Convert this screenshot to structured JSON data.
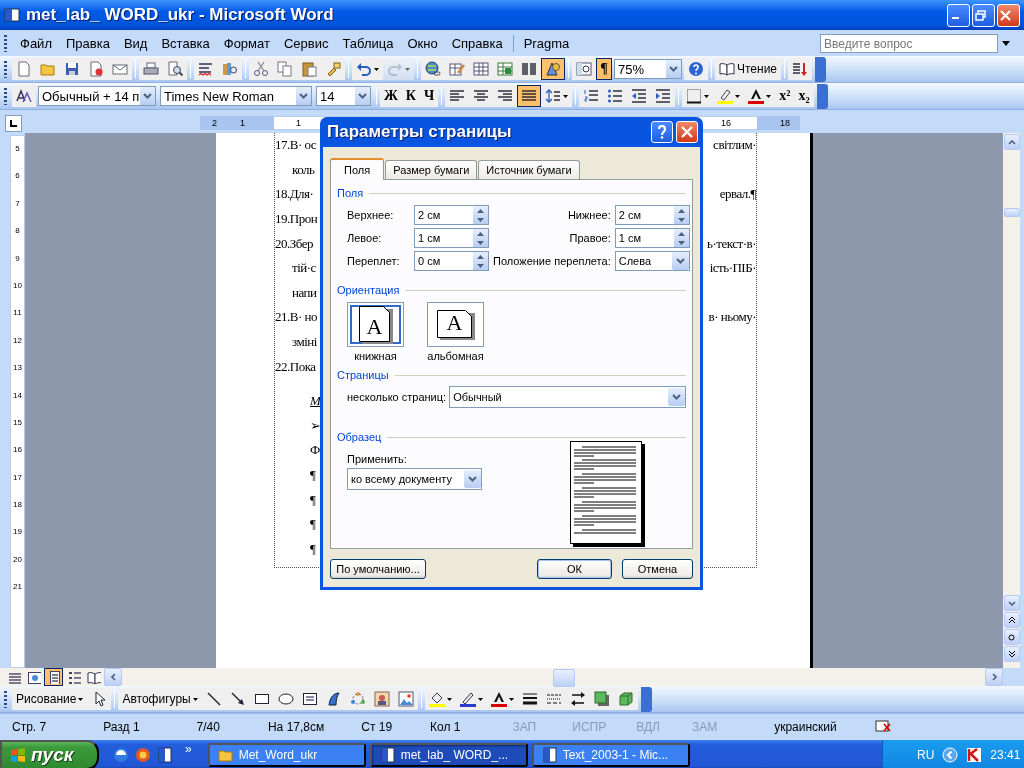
{
  "window": {
    "title": "met_lab_ WORD_ukr - Microsoft Word"
  },
  "menu": {
    "items": [
      "Файл",
      "Правка",
      "Вид",
      "Вставка",
      "Формат",
      "Сервис",
      "Таблица",
      "Окно",
      "Справка"
    ],
    "extra": [
      "Pragma"
    ],
    "help_box": {
      "placeholder": "Введите вопрос"
    }
  },
  "standard_toolbar": [
    [
      {
        "kind": "new",
        "pressed": false,
        "disabled": false
      },
      {
        "kind": "open",
        "pressed": false,
        "disabled": false
      },
      {
        "kind": "save",
        "pressed": false,
        "disabled": false
      },
      {
        "kind": "perm",
        "pressed": false,
        "disabled": false
      },
      {
        "kind": "mail",
        "pressed": false,
        "disabled": false
      }
    ],
    [
      {
        "kind": "print",
        "pressed": false,
        "disabled": false
      },
      {
        "kind": "preview",
        "pressed": false,
        "disabled": false
      }
    ],
    [
      {
        "kind": "spell",
        "pressed": false,
        "disabled": false
      },
      {
        "kind": "research",
        "pressed": false,
        "disabled": false
      }
    ],
    [
      {
        "kind": "cut",
        "pressed": false,
        "disabled": false
      },
      {
        "kind": "copy",
        "pressed": false,
        "disabled": false
      },
      {
        "kind": "paste",
        "pressed": false,
        "disabled": false
      },
      {
        "kind": "painter",
        "pressed": false,
        "disabled": false
      }
    ],
    [
      {
        "kind": "undo",
        "pressed": false,
        "disabled": false
      },
      {
        "kind": "redo",
        "pressed": false,
        "disabled": true
      }
    ],
    [
      {
        "kind": "link",
        "pressed": false,
        "disabled": false
      },
      {
        "kind": "tables",
        "pressed": false,
        "disabled": false
      },
      {
        "kind": "table",
        "pressed": false,
        "disabled": false
      },
      {
        "kind": "excel",
        "pressed": false,
        "disabled": false
      },
      {
        "kind": "columns",
        "pressed": false,
        "disabled": false
      },
      {
        "kind": "drawing",
        "pressed": true,
        "disabled": false
      }
    ],
    [
      {
        "kind": "docmap",
        "pressed": false,
        "disabled": false
      },
      {
        "kind": "text",
        "label": "¶",
        "pressed": true,
        "disabled": false
      },
      {
        "kind": "zoom",
        "value": "75%",
        "pressed": false,
        "disabled": false
      },
      {
        "kind": "help",
        "pressed": false,
        "disabled": false
      }
    ],
    [
      {
        "kind": "reading",
        "label": "Чтение",
        "pressed": false,
        "disabled": false
      }
    ],
    [
      {
        "kind": "sortlist",
        "pressed": false,
        "disabled": false
      }
    ]
  ],
  "formatting_toolbar": [
    [
      {
        "kind": "styles",
        "pressed": false,
        "disabled": false
      },
      {
        "kind": "style",
        "value": "Обычный + 14 п",
        "pressed": false,
        "disabled": false
      },
      {
        "kind": "font",
        "value": "Times New Roman",
        "pressed": false,
        "disabled": false
      },
      {
        "kind": "size",
        "value": "14",
        "pressed": false,
        "disabled": false
      }
    ],
    [
      {
        "kind": "text",
        "label": "Ж",
        "pressed": false,
        "disabled": false
      },
      {
        "kind": "text",
        "label": "К",
        "pressed": false,
        "disabled": false
      },
      {
        "kind": "text",
        "label": "Ч",
        "pressed": false,
        "disabled": false
      }
    ],
    [
      {
        "kind": "left",
        "pressed": false,
        "disabled": false
      },
      {
        "kind": "center",
        "pressed": false,
        "disabled": false
      },
      {
        "kind": "right",
        "pressed": false,
        "disabled": false
      },
      {
        "kind": "justify",
        "pressed": true,
        "disabled": false
      },
      {
        "kind": "spacing",
        "pressed": false,
        "disabled": false
      }
    ],
    [
      {
        "kind": "numbering",
        "pressed": false,
        "disabled": false
      },
      {
        "kind": "bullets",
        "pressed": false,
        "disabled": false
      },
      {
        "kind": "outdent",
        "pressed": false,
        "disabled": false
      },
      {
        "kind": "indent",
        "pressed": false,
        "disabled": false
      }
    ],
    [
      {
        "kind": "borders",
        "pressed": false,
        "disabled": false
      },
      {
        "kind": "highlight",
        "pressed": false,
        "disabled": false
      },
      {
        "kind": "fontcolor",
        "pressed": false,
        "disabled": false
      },
      {
        "kind": "text",
        "label": "x²",
        "pressed": false,
        "disabled": false
      },
      {
        "kind": "text",
        "label": "x₂",
        "pressed": false,
        "disabled": false
      }
    ]
  ],
  "ruler": {
    "labels": [
      "2",
      "1",
      "1",
      "16",
      "18"
    ],
    "vertical_labels": [
      "5",
      "6",
      "7",
      "8",
      "9",
      "10",
      "11",
      "12",
      "13",
      "14",
      "15",
      "16",
      "17",
      "18",
      "19",
      "20",
      "21"
    ]
  },
  "document": {
    "lines": [
      {
        "kind": "item",
        "left": "17.В· ос",
        "right": "світлим·"
      },
      {
        "kind": "cont",
        "left": "коль"
      },
      {
        "kind": "item",
        "left": "18.Для·",
        "right": "ервал.¶"
      },
      {
        "kind": "item",
        "left": "19.Прон"
      },
      {
        "kind": "item",
        "left": "20.Збер",
        "right": "ь·текст·в·"
      },
      {
        "kind": "cont",
        "left": "тій·с",
        "right": "ість·ПІБ·"
      },
      {
        "kind": "cont",
        "left": "напи"
      },
      {
        "kind": "item",
        "left": "21.В· но",
        "right": "в· ньому·"
      },
      {
        "kind": "cont",
        "left": "зміні"
      },
      {
        "kind": "item",
        "left": "22.Пока"
      },
      {
        "kind": "head",
        "left": "М"
      },
      {
        "kind": "sub",
        "left": "➢"
      },
      {
        "kind": "sub",
        "left": "Ф"
      },
      {
        "kind": "sub",
        "left": "¶"
      },
      {
        "kind": "sub",
        "left": "¶"
      },
      {
        "kind": "sub",
        "left": "¶"
      },
      {
        "kind": "sub",
        "left": "¶"
      }
    ]
  },
  "views": [
    {
      "kind": "normal",
      "selected": false
    },
    {
      "kind": "web",
      "selected": false
    },
    {
      "kind": "print",
      "selected": true
    },
    {
      "kind": "outline",
      "selected": false
    },
    {
      "kind": "reading",
      "selected": false
    }
  ],
  "dialog": {
    "title": "Параметры страницы",
    "tabs": [
      {
        "label": "Поля",
        "selected": true
      },
      {
        "label": "Размер бумаги",
        "selected": false
      },
      {
        "label": "Источник бумаги",
        "selected": false
      }
    ],
    "margins": {
      "title": "Поля",
      "rows": [
        {
          "left_label": "Верхнее:",
          "left_value": "2 см",
          "right_label": "Нижнее:",
          "right_value": "2 см"
        },
        {
          "left_label": "Левое:",
          "left_value": "1 см",
          "right_label": "Правое:",
          "right_value": "1 см"
        },
        {
          "left_label": "Переплет:",
          "left_value": "0 см",
          "right_label": "Положение переплета:",
          "right_value": "Слева"
        }
      ]
    },
    "orientation": {
      "title": "Ориентация",
      "options": [
        {
          "kind": "portrait",
          "glyph": "A",
          "label": "книжная",
          "selected": true
        },
        {
          "kind": "landscape",
          "glyph": "A",
          "label": "альбомная",
          "selected": false
        }
      ]
    },
    "pages": {
      "title": "Страницы",
      "label": "несколько страниц:",
      "value": "Обычный"
    },
    "preview": {
      "title": "Образец",
      "apply_label": "Применить:",
      "apply_value": "ко всему документу"
    },
    "buttons": [
      {
        "label": "По умолчанию...",
        "kind": "default"
      },
      {
        "label": "ОК",
        "kind": "ok"
      },
      {
        "label": "Отмена",
        "kind": "cancel"
      }
    ]
  },
  "drawing_toolbar": [
    [
      {
        "kind": "menu",
        "label": "Рисование",
        "pressed": false,
        "disabled": false
      },
      {
        "kind": "pointer",
        "pressed": false,
        "disabled": false
      }
    ],
    [
      {
        "kind": "menu",
        "label": "Автофигуры",
        "pressed": false,
        "disabled": false
      },
      {
        "kind": "line",
        "pressed": false,
        "disabled": false
      },
      {
        "kind": "arrow",
        "pressed": false,
        "disabled": false
      },
      {
        "kind": "rect",
        "pressed": false,
        "disabled": false
      },
      {
        "kind": "oval",
        "pressed": false,
        "disabled": false
      },
      {
        "kind": "textbox",
        "pressed": false,
        "disabled": false
      },
      {
        "kind": "wordart",
        "pressed": false,
        "disabled": false
      },
      {
        "kind": "diagram",
        "pressed": false,
        "disabled": false
      },
      {
        "kind": "clipart",
        "pressed": false,
        "disabled": false
      },
      {
        "kind": "picture",
        "pressed": false,
        "disabled": false
      }
    ],
    [
      {
        "kind": "fill",
        "pressed": false,
        "disabled": false
      },
      {
        "kind": "linecolor",
        "pressed": false,
        "disabled": false
      },
      {
        "kind": "fontcolor",
        "pressed": false,
        "disabled": false
      },
      {
        "kind": "linestyle",
        "pressed": false,
        "disabled": false
      },
      {
        "kind": "dash",
        "pressed": false,
        "disabled": false
      },
      {
        "kind": "arrows",
        "pressed": false,
        "disabled": false
      },
      {
        "kind": "shadow",
        "pressed": false,
        "disabled": false
      },
      {
        "kind": "cube",
        "pressed": false,
        "disabled": false
      }
    ]
  ],
  "status_bar": [
    {
      "text": "Стр. 7",
      "disabled": false
    },
    {
      "text": "Разд 1",
      "disabled": false
    },
    {
      "text": "7/40",
      "disabled": false
    },
    {
      "text": "На 17,8см",
      "disabled": false
    },
    {
      "text": "Ст 19",
      "disabled": false
    },
    {
      "text": "Кол 1",
      "disabled": false
    },
    {
      "text": "ЗАП",
      "disabled": true
    },
    {
      "text": "ИСПР",
      "disabled": true
    },
    {
      "text": "ВДЛ",
      "disabled": true
    },
    {
      "text": "ЗАМ",
      "disabled": true
    },
    {
      "text": "украинский",
      "disabled": false
    }
  ],
  "taskbar": {
    "start": "пуск",
    "more": "»",
    "tasks": [
      {
        "kind": "folder",
        "label": "Met_Word_ukr",
        "selected": false
      },
      {
        "kind": "word",
        "label": "met_lab_ WORD_...",
        "selected": true
      },
      {
        "kind": "word",
        "label": "Text_2003-1 - Mic...",
        "selected": false
      }
    ],
    "language": "RU",
    "time": "23:41"
  }
}
